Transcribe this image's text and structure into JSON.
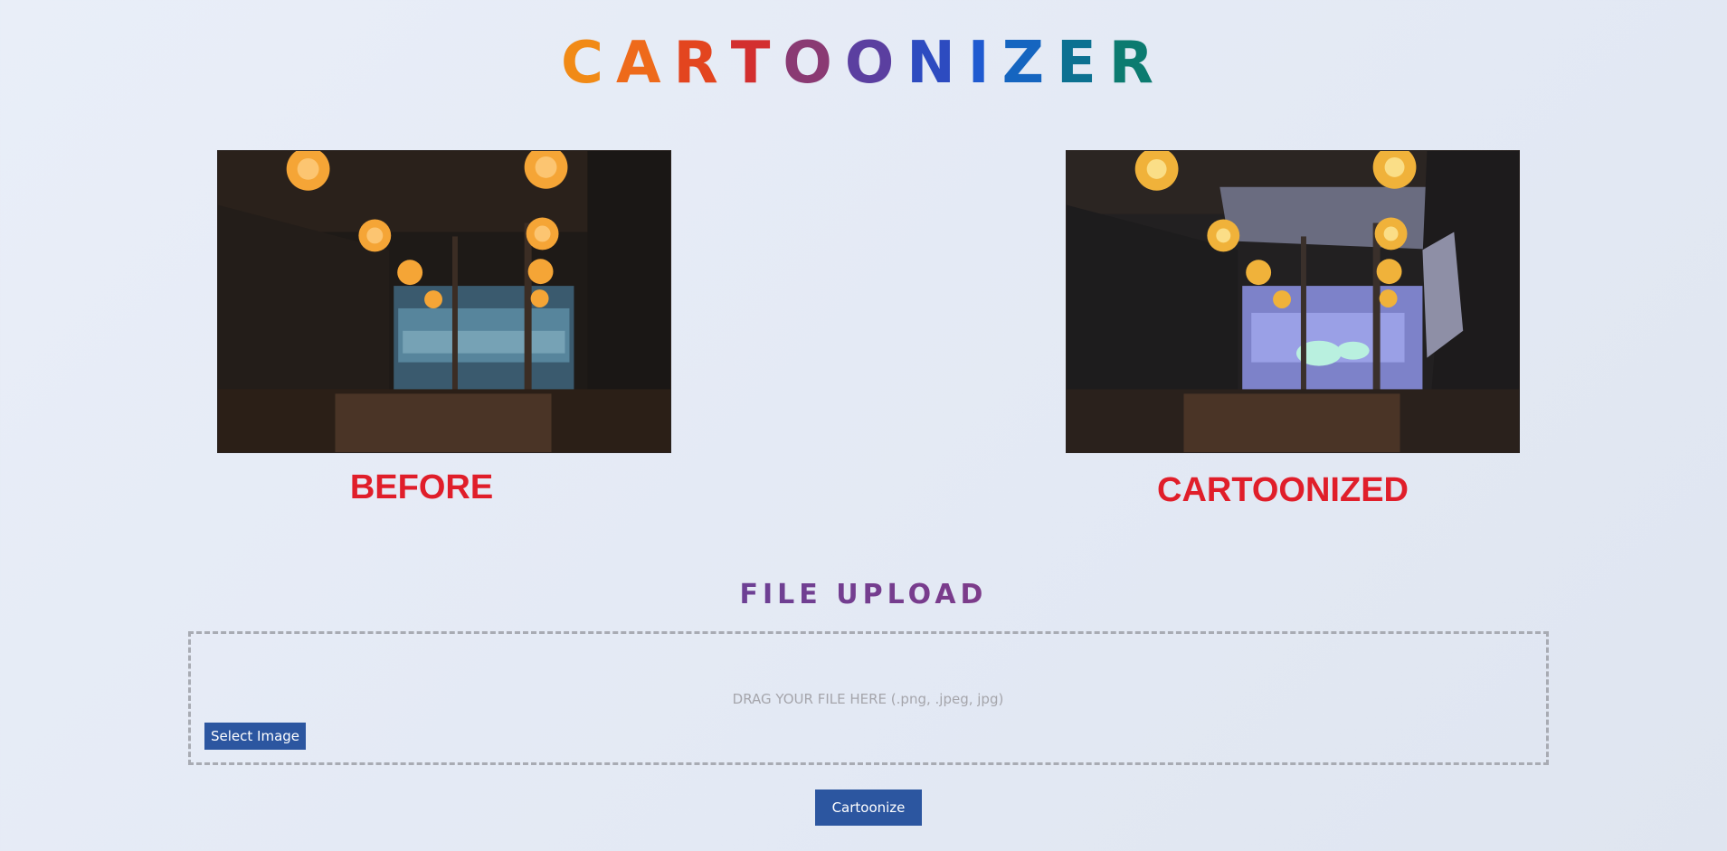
{
  "app": {
    "title_letters": [
      {
        "ch": "C",
        "color": "#f18a16"
      },
      {
        "ch": "A",
        "color": "#ee6a1a"
      },
      {
        "ch": "R",
        "color": "#e3451f"
      },
      {
        "ch": "T",
        "color": "#d32f2f"
      },
      {
        "ch": "O",
        "color": "#8a3a73"
      },
      {
        "ch": "O",
        "color": "#5b3fa0"
      },
      {
        "ch": "N",
        "color": "#2d4bc0"
      },
      {
        "ch": "I",
        "color": "#1f5ad0"
      },
      {
        "ch": "Z",
        "color": "#1565c0"
      },
      {
        "ch": "E",
        "color": "#0c7191"
      },
      {
        "ch": "R",
        "color": "#0c7b70"
      }
    ]
  },
  "preview": {
    "before_caption": "BEFORE",
    "after_caption": "CARTOONIZED",
    "caption_color": "#e01e2a"
  },
  "upload": {
    "heading": "FILE UPLOAD",
    "drop_text": "DRAG YOUR FILE HERE (.png, .jpeg, jpg)",
    "select_button": "Select Image"
  },
  "actions": {
    "cartoonize_button": "Cartoonize"
  },
  "theme": {
    "button_color": "#2c56a0"
  }
}
